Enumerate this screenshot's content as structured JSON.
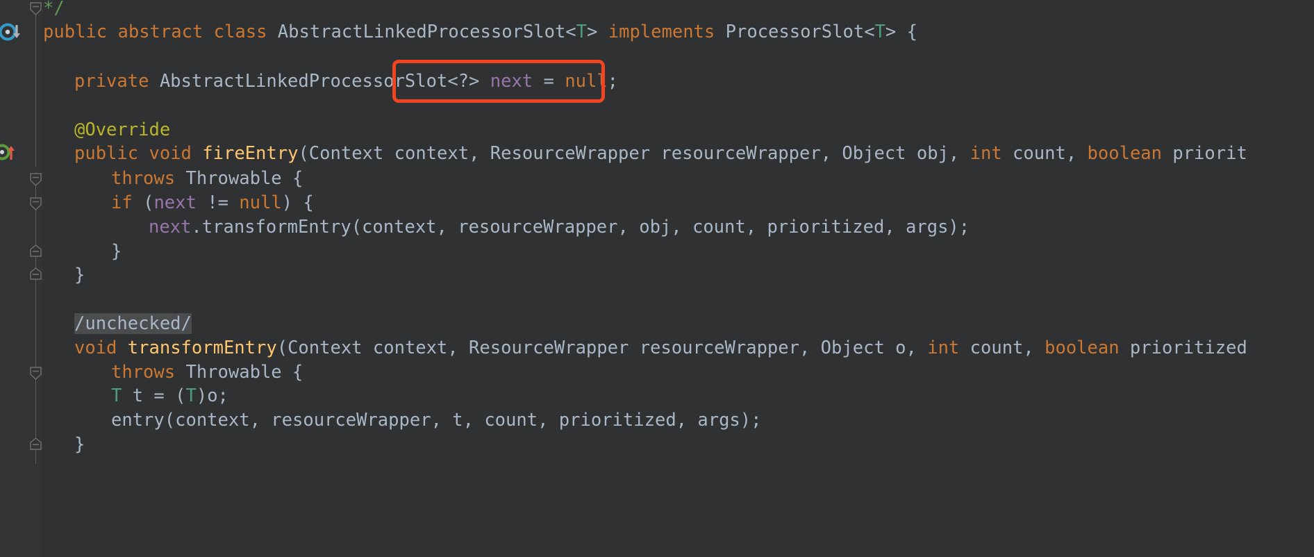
{
  "editor": {
    "theme": "darcula",
    "background_color": "#2f3132",
    "gutter_color": "#313335",
    "default_text_color": "#a9b7c6",
    "keyword_color": "#cc7832",
    "field_color": "#9876aa",
    "method_color": "#ffc66d",
    "annotation_color": "#bbb529",
    "comment_color": "#629755",
    "type_param_color": "#4f9c86",
    "highlight_background": "#4a4c4e",
    "annotation_box_color": "#f04422"
  },
  "gutter": {
    "icons": [
      {
        "name": "implementing-method-icon",
        "label": "O",
        "color": "#359ac6",
        "arrow": "down",
        "arrow_color": "#b0b3b5"
      },
      {
        "name": "overriding-method-icon",
        "label": "O",
        "color": "#5a9c3a",
        "arrow": "up",
        "arrow_color": "#e05c4a"
      }
    ],
    "fold_markers": [
      {
        "name": "fold-marker-comment-end",
        "type": "down"
      },
      {
        "name": "fold-marker-method-start",
        "type": "down"
      },
      {
        "name": "fold-marker-block-start",
        "type": "down"
      },
      {
        "name": "fold-marker-block-end",
        "type": "up"
      },
      {
        "name": "fold-marker-method-end",
        "type": "up"
      },
      {
        "name": "fold-marker-second-method-start",
        "type": "down"
      },
      {
        "name": "fold-marker-second-method-end",
        "type": "up"
      }
    ]
  },
  "annotation": {
    "name": "red-highlight-box",
    "target_text": "<?> next = null;",
    "color": "#f04422"
  },
  "code": {
    "lines": [
      {
        "id": "line-comment-close",
        "indent": 0,
        "tokens": [
          {
            "t": "*/",
            "c": "comment"
          }
        ]
      },
      {
        "id": "line-class-declaration",
        "indent": 0,
        "tokens": [
          {
            "t": "public",
            "c": "kw"
          },
          {
            "t": " ",
            "c": "punct"
          },
          {
            "t": "abstract",
            "c": "kw"
          },
          {
            "t": " ",
            "c": "punct"
          },
          {
            "t": "class",
            "c": "kw"
          },
          {
            "t": " AbstractLinkedProcessorSlot<",
            "c": "ident"
          },
          {
            "t": "T",
            "c": "typeparam"
          },
          {
            "t": "> ",
            "c": "ident"
          },
          {
            "t": "implements",
            "c": "kw"
          },
          {
            "t": " ProcessorSlot<",
            "c": "ident"
          },
          {
            "t": "T",
            "c": "typeparam"
          },
          {
            "t": "> {",
            "c": "ident"
          }
        ]
      },
      {
        "id": "line-field-next",
        "indent": 1,
        "tokens": [
          {
            "t": "private",
            "c": "kw"
          },
          {
            "t": " AbstractLinkedProcessorSlot<?> ",
            "c": "ident"
          },
          {
            "t": "next",
            "c": "field"
          },
          {
            "t": " = ",
            "c": "ident"
          },
          {
            "t": "null",
            "c": "kw"
          },
          {
            "t": ";",
            "c": "ident"
          }
        ]
      },
      {
        "id": "line-override-annotation",
        "indent": 1,
        "tokens": [
          {
            "t": "@Override",
            "c": "anno"
          }
        ]
      },
      {
        "id": "line-fire-entry-signature",
        "indent": 1,
        "tokens": [
          {
            "t": "public",
            "c": "kw"
          },
          {
            "t": " ",
            "c": "punct"
          },
          {
            "t": "void",
            "c": "kw"
          },
          {
            "t": " ",
            "c": "punct"
          },
          {
            "t": "fireEntry",
            "c": "method"
          },
          {
            "t": "(Context context, ResourceWrapper resourceWrapper, Object obj, ",
            "c": "ident"
          },
          {
            "t": "int",
            "c": "kw"
          },
          {
            "t": " count, ",
            "c": "ident"
          },
          {
            "t": "boolean",
            "c": "kw"
          },
          {
            "t": " priorit",
            "c": "ident"
          }
        ]
      },
      {
        "id": "line-fire-entry-throws",
        "indent": 2,
        "tokens": [
          {
            "t": "throws",
            "c": "kw"
          },
          {
            "t": " Throwable {",
            "c": "ident"
          }
        ]
      },
      {
        "id": "line-if-next-not-null",
        "indent": 2,
        "tokens": [
          {
            "t": "if",
            "c": "kw"
          },
          {
            "t": " (",
            "c": "ident"
          },
          {
            "t": "next",
            "c": "field"
          },
          {
            "t": " != ",
            "c": "ident"
          },
          {
            "t": "null",
            "c": "kw"
          },
          {
            "t": ") {",
            "c": "ident"
          }
        ]
      },
      {
        "id": "line-next-transform-entry",
        "indent": 3,
        "tokens": [
          {
            "t": "next",
            "c": "field"
          },
          {
            "t": ".transformEntry(context, resourceWrapper, obj, count, prioritized, args);",
            "c": "ident"
          }
        ]
      },
      {
        "id": "line-close-if",
        "indent": 2,
        "tokens": [
          {
            "t": "}",
            "c": "ident"
          }
        ]
      },
      {
        "id": "line-close-fire-entry",
        "indent": 1,
        "tokens": [
          {
            "t": "}",
            "c": "ident"
          }
        ]
      },
      {
        "id": "line-unchecked-comment",
        "indent": 1,
        "tokens": [
          {
            "t": "/unchecked/",
            "c": "unchecked-hl"
          }
        ]
      },
      {
        "id": "line-transform-entry-signature",
        "indent": 1,
        "tokens": [
          {
            "t": "void",
            "c": "kw"
          },
          {
            "t": " ",
            "c": "punct"
          },
          {
            "t": "transformEntry",
            "c": "method"
          },
          {
            "t": "(Context context, ResourceWrapper resourceWrapper, Object o, ",
            "c": "ident"
          },
          {
            "t": "int",
            "c": "kw"
          },
          {
            "t": " count, ",
            "c": "ident"
          },
          {
            "t": "boolean",
            "c": "kw"
          },
          {
            "t": " prioritized",
            "c": "ident"
          }
        ]
      },
      {
        "id": "line-transform-entry-throws",
        "indent": 2,
        "tokens": [
          {
            "t": "throws",
            "c": "kw"
          },
          {
            "t": " Throwable {",
            "c": "ident"
          }
        ]
      },
      {
        "id": "line-cast-t",
        "indent": 2,
        "tokens": [
          {
            "t": "T",
            "c": "typeparam"
          },
          {
            "t": " t = (",
            "c": "ident"
          },
          {
            "t": "T",
            "c": "typeparam"
          },
          {
            "t": ")o;",
            "c": "ident"
          }
        ]
      },
      {
        "id": "line-entry-call",
        "indent": 2,
        "tokens": [
          {
            "t": "entry(context, resourceWrapper, t, count, prioritized, args);",
            "c": "ident"
          }
        ]
      },
      {
        "id": "line-close-transform-entry",
        "indent": 1,
        "tokens": [
          {
            "t": "}",
            "c": "ident"
          }
        ]
      }
    ]
  }
}
